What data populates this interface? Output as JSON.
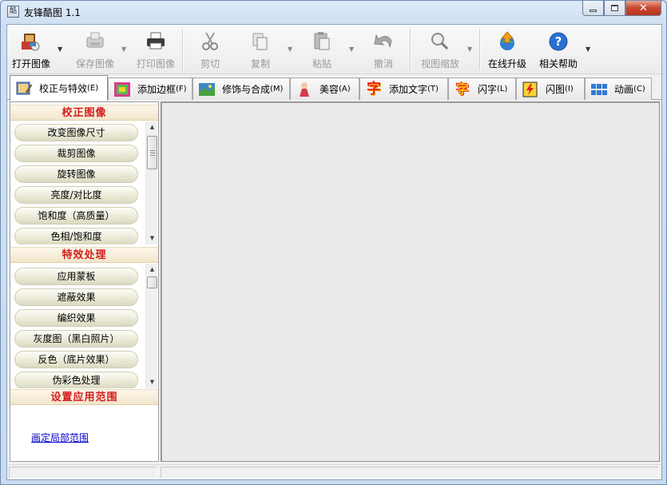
{
  "window": {
    "title": "友锋酷图 1.1",
    "icon": "app-logo-icon",
    "controls": {
      "minimize": "minimize-icon",
      "maximize": "maximize-icon",
      "close": "close-icon"
    }
  },
  "toolbar": {
    "items": [
      {
        "label": "打开图像",
        "icon": "open-image-icon",
        "enabled": true,
        "dropdown": true
      },
      {
        "label": "保存图像",
        "icon": "save-image-icon",
        "enabled": false,
        "dropdown": true
      },
      {
        "label": "打印图像",
        "icon": "print-icon",
        "enabled": false,
        "dropdown": false
      },
      {
        "label": "剪切",
        "icon": "cut-icon",
        "enabled": false,
        "dropdown": false
      },
      {
        "label": "复制",
        "icon": "copy-icon",
        "enabled": false,
        "dropdown": true
      },
      {
        "label": "粘贴",
        "icon": "paste-icon",
        "enabled": false,
        "dropdown": true
      },
      {
        "label": "撤消",
        "icon": "undo-icon",
        "enabled": false,
        "dropdown": false
      },
      {
        "label": "视图缩放",
        "icon": "zoom-icon",
        "enabled": false,
        "dropdown": true
      },
      {
        "label": "在线升级",
        "icon": "online-upgrade-icon",
        "enabled": true,
        "dropdown": false
      },
      {
        "label": "相关帮助",
        "icon": "help-icon",
        "enabled": true,
        "dropdown": true
      }
    ]
  },
  "tabs": [
    {
      "label": "校正与特效",
      "shortcut": "(E)",
      "icon": "correction-effects-icon",
      "active": true
    },
    {
      "label": "添加边框",
      "shortcut": "(F)",
      "icon": "add-border-icon",
      "active": false
    },
    {
      "label": "修饰与合成",
      "shortcut": "(M)",
      "icon": "decorate-compose-icon",
      "active": false
    },
    {
      "label": "美容",
      "shortcut": "(A)",
      "icon": "beauty-icon",
      "active": false
    },
    {
      "label": "添加文字",
      "shortcut": "(T)",
      "icon": "add-text-icon",
      "active": false
    },
    {
      "label": "闪字",
      "shortcut": "(L)",
      "icon": "flash-text-icon",
      "active": false
    },
    {
      "label": "闪图",
      "shortcut": "(I)",
      "icon": "flash-image-icon",
      "active": false
    },
    {
      "label": "动画",
      "shortcut": "(C)",
      "icon": "animation-icon",
      "active": false
    }
  ],
  "left_panel": {
    "sections": [
      {
        "title": "校正图像",
        "items": [
          "改变图像尺寸",
          "裁剪图像",
          "旋转图像",
          "亮度/对比度",
          "饱和度（高质量）",
          "色相/饱和度"
        ]
      },
      {
        "title": "特效处理",
        "items": [
          "应用蒙板",
          "遮蔽效果",
          "编织效果",
          "灰度图（黑白照片）",
          "反色（底片效果）",
          "伪彩色处理"
        ]
      },
      {
        "title": "设置应用范围",
        "link": "画定局部范围"
      }
    ]
  },
  "colors": {
    "section_title": "#d21d1d",
    "link": "#0000cc",
    "frame": "#c9dbf0"
  }
}
